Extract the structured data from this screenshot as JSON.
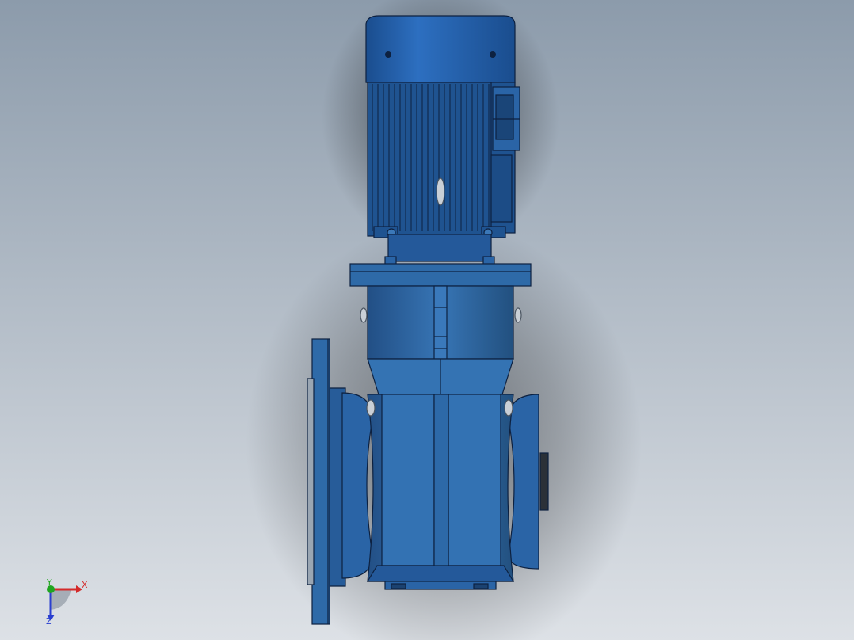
{
  "viewport": {
    "background_top": "#8c9bab",
    "background_bottom": "#dde1e6"
  },
  "model": {
    "body_color": "#2f6aa8",
    "highlight_color": "#5b92cc",
    "shadow_color": "#1b4271",
    "edge_color": "#0d2140",
    "cap_color": "#1c5aa8"
  },
  "triad": {
    "x_label": "X",
    "y_label": "Y",
    "z_label": "Z",
    "x_color": "#d42a2a",
    "y_color": "#1fa51f",
    "z_color": "#2a3fd0"
  }
}
